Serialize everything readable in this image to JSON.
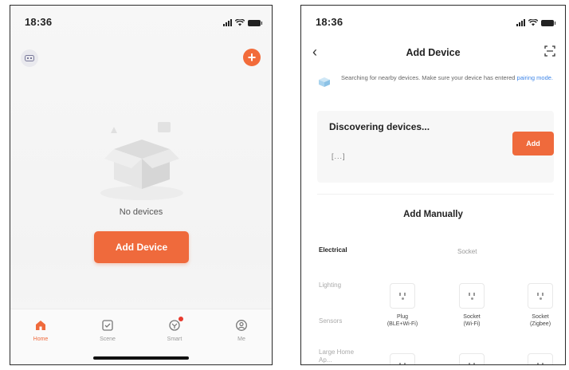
{
  "left_screen": {
    "status_time": "18:36",
    "no_devices_text": "No devices",
    "add_device_button": "Add Device",
    "tabs": [
      {
        "label": "Home",
        "icon": "home-icon",
        "active": true
      },
      {
        "label": "Scene",
        "icon": "scene-icon",
        "active": false
      },
      {
        "label": "Smart",
        "icon": "smart-icon",
        "active": false
      },
      {
        "label": "Me",
        "icon": "me-icon",
        "active": false
      }
    ]
  },
  "right_screen": {
    "status_time": "18:36",
    "title": "Add Device",
    "notice_text": "Searching for nearby devices. Make sure your device has entered",
    "notice_link": "pairing mode.",
    "discovering_title": "Discovering devices...",
    "discovering_dots": "...",
    "add_button": "Add",
    "manual_title": "Add Manually",
    "categories": [
      {
        "label": "Electrical",
        "active": true
      },
      {
        "label": "Lighting",
        "active": false
      },
      {
        "label": "Sensors",
        "active": false
      },
      {
        "label": "Large Home Ap...",
        "active": false
      }
    ],
    "subheading": "Socket",
    "devices": [
      {
        "name": "Plug",
        "detail": "(BLE+Wi-Fi)"
      },
      {
        "name": "Socket",
        "detail": "(Wi-Fi)"
      },
      {
        "name": "Socket",
        "detail": "(Zigbee)"
      }
    ]
  },
  "colors": {
    "accent": "#ef6a3c",
    "link": "#3f86e8",
    "badge": "#e83b2f"
  }
}
